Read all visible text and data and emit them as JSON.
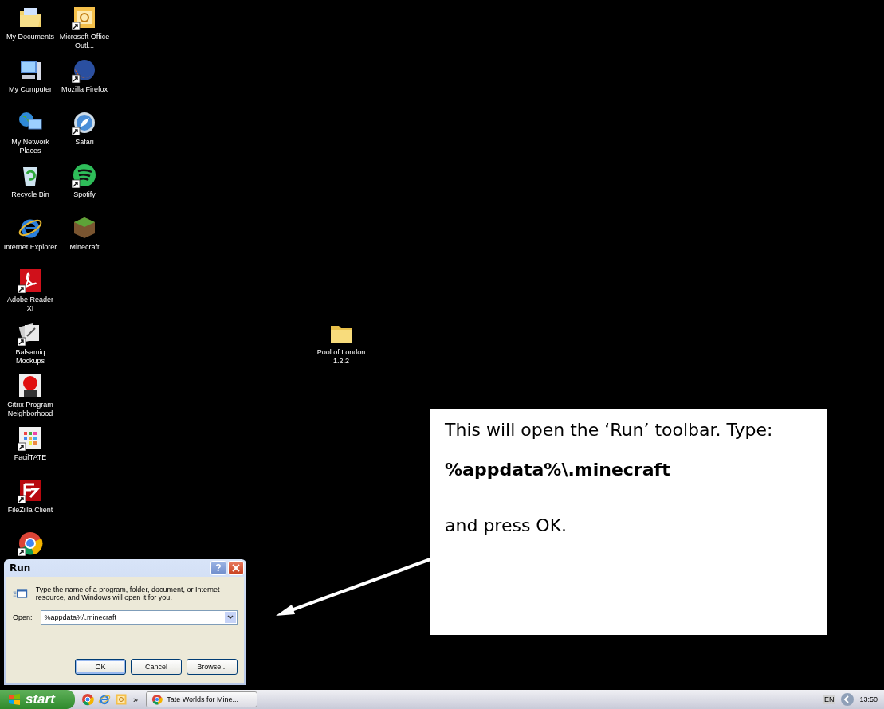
{
  "desktop_icons": [
    {
      "label": "My Documents",
      "kind": "documents",
      "shortcut": false
    },
    {
      "label": "My Computer",
      "kind": "computer",
      "shortcut": false
    },
    {
      "label": "My Network Places",
      "kind": "network",
      "shortcut": false
    },
    {
      "label": "Recycle Bin",
      "kind": "recycle",
      "shortcut": false
    },
    {
      "label": "Internet Explorer",
      "kind": "ie",
      "shortcut": false
    },
    {
      "label": "Adobe Reader XI",
      "kind": "pdf",
      "shortcut": true
    },
    {
      "label": "Balsamiq Mockups",
      "kind": "papers",
      "shortcut": true
    },
    {
      "label": "Citrix Program Neighborhood",
      "kind": "citrix",
      "shortcut": false
    },
    {
      "label": "FacilTATE",
      "kind": "grid",
      "shortcut": true
    },
    {
      "label": "FileZilla Client",
      "kind": "filezilla",
      "shortcut": true
    },
    {
      "kind": "chrome",
      "shortcut": true
    },
    {
      "label": "Microsoft Office Outl...",
      "kind": "outlook",
      "shortcut": true
    },
    {
      "label": "Mozilla Firefox",
      "kind": "firefox",
      "shortcut": true
    },
    {
      "label": "Safari",
      "kind": "compass",
      "shortcut": true
    },
    {
      "label": "Spotify",
      "kind": "spotify",
      "shortcut": true
    },
    {
      "label": "Minecraft",
      "kind": "block",
      "shortcut": false
    }
  ],
  "folder_icon": {
    "label": "Pool of London 1.2.2"
  },
  "callout": {
    "line_1": "This will open the ‘Run’ toolbar. Type:",
    "command": "%appdata%\\.minecraft",
    "line_2": "and press OK."
  },
  "run_dialog": {
    "title": "Run",
    "help_button": "?",
    "description": "Type the name of a program, folder, document, or Internet resource, and Windows will open it for you.",
    "open_label": "Open:",
    "open_value": "%appdata%\\.minecraft",
    "buttons": [
      "OK",
      "Cancel",
      "Browse..."
    ]
  },
  "taskbar": {
    "start": "start",
    "quick_launch": [
      {
        "kind": "chrome"
      },
      {
        "kind": "ie"
      },
      {
        "kind": "outlook"
      }
    ],
    "chevron": "»",
    "task": "Tate Worlds for Mine...",
    "language": "EN",
    "clock": "13:50"
  }
}
